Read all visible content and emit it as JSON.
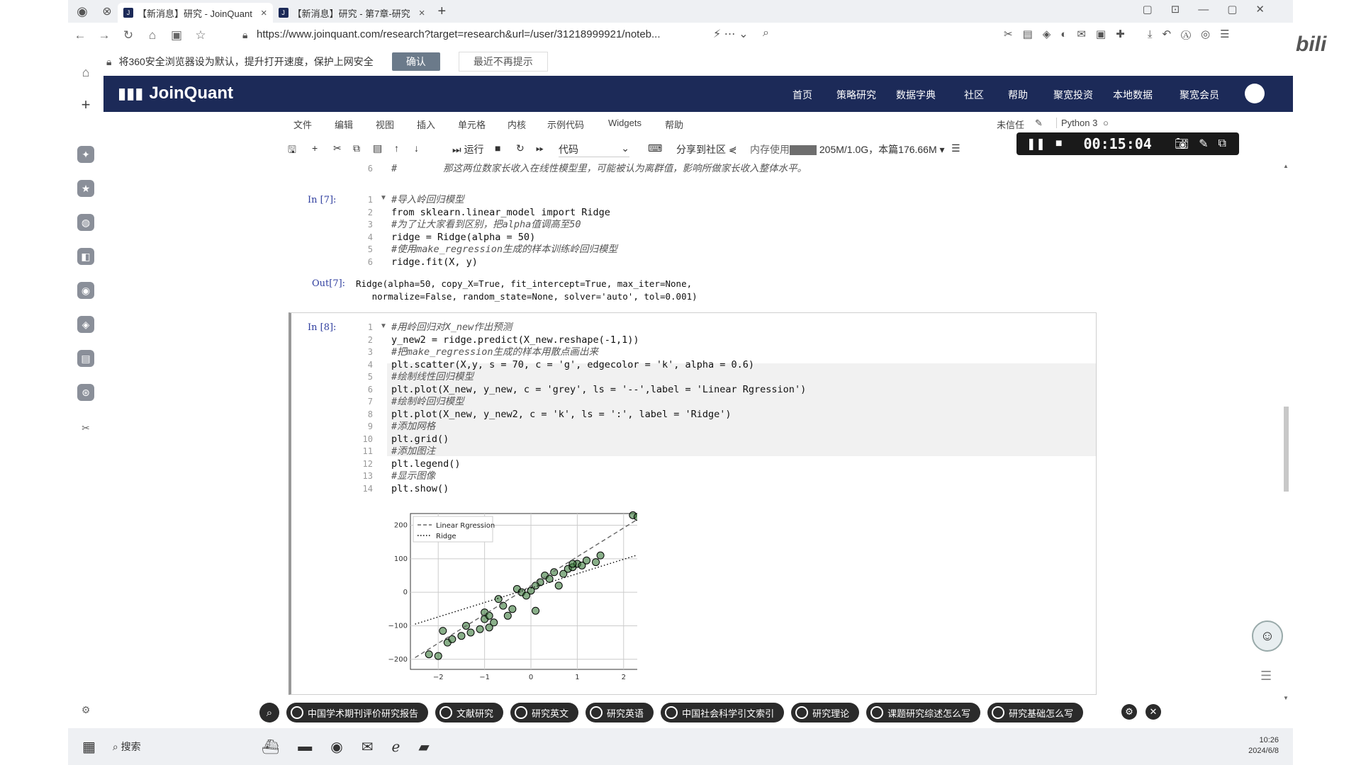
{
  "browser": {
    "tabs": [
      {
        "label": "【新消息】研究 - JoinQuant",
        "active": true
      },
      {
        "label": "【新消息】研究 - 第7章-研究",
        "active": false
      }
    ],
    "url": "https://www.joinquant.com/research?target=research&url=/user/31218999921/noteb...",
    "infobar_text": "将360安全浏览器设为默认，提升打开速度，保护上网安全",
    "infobar_button": "确认",
    "infobar_dismiss": "最近不再提示"
  },
  "site": {
    "logo": "JoinQuant",
    "nav": [
      "首页",
      "策略研究",
      "数据字典",
      "社区",
      "帮助",
      "聚宽投资",
      "本地数据",
      "聚宽会员"
    ]
  },
  "menubar": {
    "items": [
      "文件",
      "编辑",
      "视图",
      "插入",
      "单元格",
      "内核",
      "示例代码",
      "Widgets",
      "帮助"
    ],
    "trust": "未信任",
    "kernel": "Python 3"
  },
  "toolbar": {
    "run": "运行",
    "cell_type": "代码",
    "share": "分享到社区",
    "memory_label": "内存使用",
    "memory_value": "205M/1.0G，本篇176.66M"
  },
  "recorder": {
    "time": "00:15:04"
  },
  "notebook": {
    "prev_cell_comment": "#        那这两位数家长收入在线性模型里，可能被认为离群值，影响所做家长收入整体水平。",
    "prev_cell_line": "6",
    "cell7": {
      "prompt": "In  [7]:",
      "lines": [
        "#导入岭回归模型",
        "from sklearn.linear_model import Ridge",
        "#为了让大家看到区别，把alpha值调高至50",
        "ridge = Ridge(alpha = 50)",
        "#使用make_regression生成的样本训练岭回归模型",
        "ridge.fit(X, y)"
      ],
      "out_prompt": "Out[7]:",
      "output": [
        "Ridge(alpha=50, copy_X=True, fit_intercept=True, max_iter=None,",
        "   normalize=False, random_state=None, solver='auto', tol=0.001)"
      ]
    },
    "cell8": {
      "prompt": "In  [8]:",
      "lines": [
        "#用岭回归对X_new作出预测",
        "y_new2 = ridge.predict(X_new.reshape(-1,1))",
        "#把make_regression生成的样本用散点画出来",
        "plt.scatter(X,y, s = 70, c = 'g', edgecolor = 'k', alpha = 0.6)",
        "#绘制线性回归模型",
        "plt.plot(X_new, y_new, c = 'grey', ls = '--',label = 'Linear Rgression')",
        "#绘制岭回归模型",
        "plt.plot(X_new, y_new2, c = 'k', ls = ':', label = 'Ridge')",
        "#添加网格",
        "plt.grid()",
        "#添加图注",
        "plt.legend()",
        "#显示图像",
        "plt.show()"
      ]
    }
  },
  "chart_data": {
    "type": "scatter",
    "xlim": [
      -2.6,
      2.6
    ],
    "ylim": [
      -230,
      235
    ],
    "xticks": [
      -2,
      -1,
      0,
      1,
      2
    ],
    "xtick_labels": [
      "−2",
      "−1",
      "0",
      "1",
      "2"
    ],
    "yticks": [
      -200,
      -100,
      0,
      100,
      200
    ],
    "ytick_labels": [
      "−200",
      "−100",
      "0",
      "100",
      "200"
    ],
    "grid": true,
    "legend": "upper-left",
    "series": [
      {
        "name": "Linear Rgression",
        "kind": "line",
        "style": "dashed",
        "color": "#666666",
        "x": [
          -2.5,
          2.5
        ],
        "y": [
          -195,
          235
        ]
      },
      {
        "name": "Ridge",
        "kind": "line",
        "style": "dotted",
        "color": "#000000",
        "x": [
          -2.5,
          2.5
        ],
        "y": [
          -95,
          120
        ]
      },
      {
        "kind": "points",
        "x": [
          -2.2,
          -2.0,
          -1.9,
          -1.8,
          -1.7,
          -1.5,
          -1.4,
          -1.3,
          -1.1,
          -1.0,
          -1.0,
          -0.9,
          -0.8,
          -0.7,
          -0.6,
          -0.5,
          -0.4,
          -0.3,
          -0.2,
          -0.1,
          0.0,
          0.1,
          0.2,
          0.3,
          0.4,
          0.5,
          0.6,
          0.7,
          0.8,
          0.9,
          1.0,
          1.1,
          1.2,
          1.4,
          1.5,
          2.2,
          2.3,
          0.1,
          -0.9,
          0.9
        ],
        "y": [
          -185,
          -190,
          -115,
          -150,
          -140,
          -130,
          -100,
          -120,
          -110,
          -60,
          -80,
          -70,
          -90,
          -20,
          -40,
          -70,
          -50,
          10,
          0,
          -10,
          5,
          -55,
          30,
          50,
          40,
          60,
          20,
          55,
          70,
          75,
          85,
          80,
          95,
          90,
          110,
          230,
          225,
          20,
          -105,
          85
        ]
      }
    ]
  },
  "bottom_tags": [
    "中国学术期刊评价研究报告",
    "文献研究",
    "研究英文",
    "研究英语",
    "中国社会科学引文索引",
    "研究理论",
    "课题研究综述怎么写",
    "研究基础怎么写"
  ],
  "taskbar": {
    "search": "搜索",
    "time": "10:26",
    "date": "2024/6/8"
  }
}
